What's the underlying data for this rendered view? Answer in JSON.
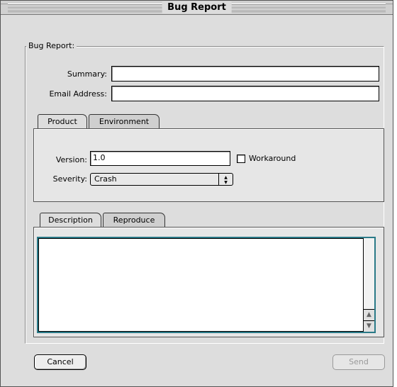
{
  "window": {
    "title": "Bug Report"
  },
  "group": {
    "label": "Bug Report:"
  },
  "fields": {
    "summary_label": "Summary:",
    "summary_value": "",
    "email_label": "Email Address:",
    "email_value": ""
  },
  "tabs_top": [
    {
      "label": "Product",
      "selected": true
    },
    {
      "label": "Environment",
      "selected": false
    }
  ],
  "product": {
    "version_label": "Version:",
    "version_value": "1.0",
    "workaround_label": "Workaround",
    "workaround_checked": false,
    "severity_label": "Severity:",
    "severity_value": "Crash"
  },
  "tabs_bottom": [
    {
      "label": "Description",
      "selected": true
    },
    {
      "label": "Reproduce",
      "selected": false
    }
  ],
  "buttons": {
    "cancel_label": "Cancel",
    "send_label": "Send"
  },
  "icons": {
    "popup_arrows": "popup-arrows-icon",
    "scroll_up": "scroll-up-icon",
    "scroll_down": "scroll-down-icon"
  },
  "colors": {
    "textarea_focus": "#2a7a88",
    "window_bg": "#dddddd"
  }
}
